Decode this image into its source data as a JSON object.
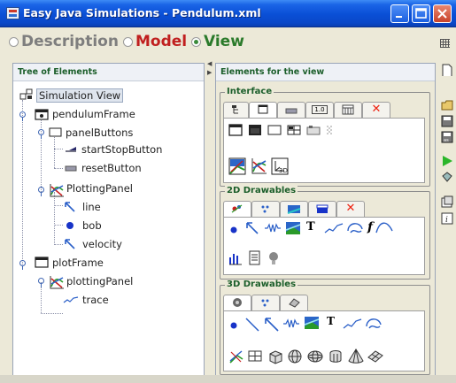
{
  "window": {
    "title": "Easy Java Simulations - Pendulum.xml"
  },
  "modes": {
    "description": "Description",
    "model": "Model",
    "view": "View",
    "selected": "View"
  },
  "tree": {
    "header": "Tree of Elements",
    "nodes": [
      {
        "label": "Simulation View",
        "icon": "simulation-view-icon"
      },
      {
        "label": "pendulumFrame",
        "icon": "frame-icon"
      },
      {
        "label": "panelButtons",
        "icon": "panel-icon"
      },
      {
        "label": "startStopButton",
        "icon": "two-state-button-icon"
      },
      {
        "label": "resetButton",
        "icon": "button-icon"
      },
      {
        "label": "PlottingPanel",
        "icon": "plotting-panel-icon"
      },
      {
        "label": "line",
        "icon": "arrow-icon"
      },
      {
        "label": "bob",
        "icon": "particle-icon"
      },
      {
        "label": "velocity",
        "icon": "arrow-icon"
      },
      {
        "label": "plotFrame",
        "icon": "frame-icon"
      },
      {
        "label": "plottingPanel",
        "icon": "plotting-panel-icon"
      },
      {
        "label": "trace",
        "icon": "trace-icon"
      }
    ]
  },
  "elements": {
    "header": "Elements for the view",
    "groups": [
      {
        "title": "Interface"
      },
      {
        "title": "2D Drawables"
      },
      {
        "title": "3D Drawables"
      }
    ],
    "interface_tab_labels": [
      "",
      "",
      "",
      "1.0",
      "",
      "✕"
    ],
    "drawables_text_glyph": "T",
    "function_glyph": "f"
  },
  "colors": {
    "title_bar": "#0a4fd6",
    "model_red": "#c01f1f",
    "view_green": "#2a7a2a",
    "header_green": "#1b5e2a",
    "close_red": "#ee2211"
  }
}
